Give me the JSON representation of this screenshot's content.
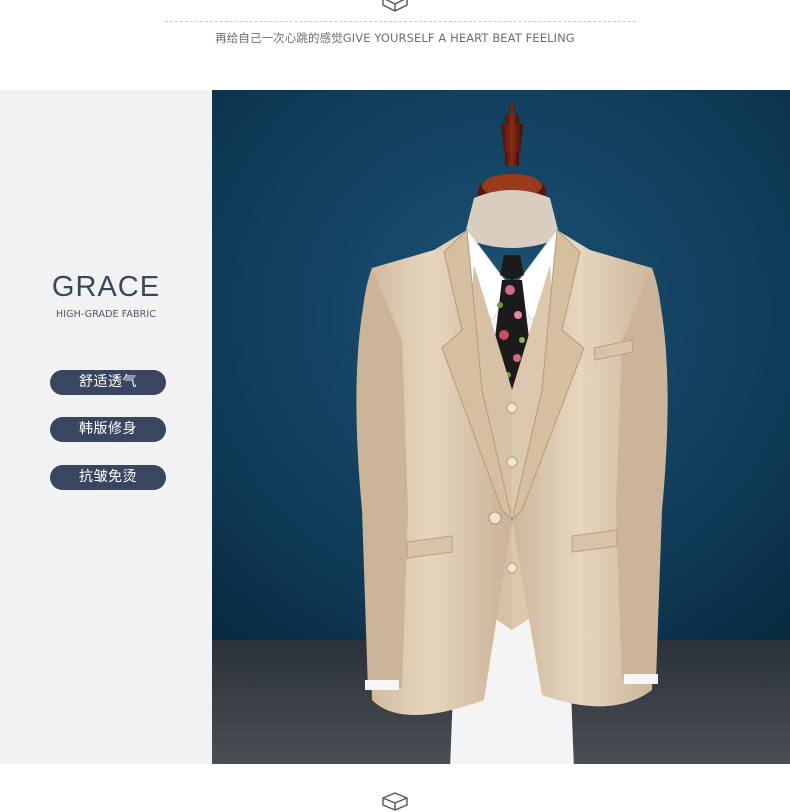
{
  "header": {
    "slogan": "再给自己一次心跳的感觉GIVE YOURSELF A HEART BEAT FEELING",
    "icon": "box-icon"
  },
  "feature_panel": {
    "title": "GRACE",
    "subtitle": "HIGH-GRADE FABRIC",
    "tags": [
      "舒适透气",
      "韩版修身",
      "抗皱免烫"
    ],
    "tag_color": "#3a4660"
  },
  "photo": {
    "subject": "beige suit jacket with vest, white shirt and floral tie on a mannequin",
    "background_color": "#0f3d5a"
  },
  "footer": {
    "icon": "box-icon"
  }
}
